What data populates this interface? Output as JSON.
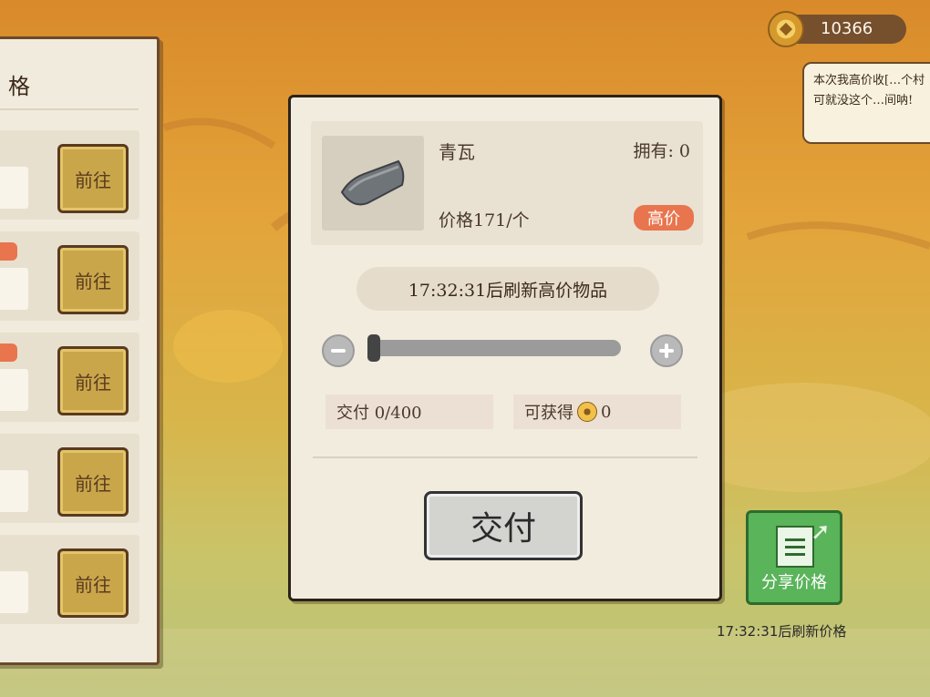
{
  "wallet": {
    "coins": "10366",
    "coin_icon": "copper-coin-icon"
  },
  "speech": {
    "text": "本次我高价收[…个村可就没这个…间呐!"
  },
  "left_panel": {
    "title": "格",
    "rows": [
      {
        "go_label": "前往"
      },
      {
        "go_label": "前往"
      },
      {
        "go_label": "前往"
      },
      {
        "go_label": "前往"
      },
      {
        "go_label": "前往"
      }
    ]
  },
  "item": {
    "name": "青瓦",
    "owned": "拥有: 0",
    "price": "价格171/个",
    "badge": "高价",
    "icon": "roof-tile-icon"
  },
  "refresh": {
    "text": "17:32:31后刷新高价物品"
  },
  "quantity": {
    "slider_fraction": 0
  },
  "deliver_info": {
    "text": "交付 0/400"
  },
  "reward_info": {
    "label": "可获得",
    "value": "0"
  },
  "actions": {
    "deliver_label": "交付"
  },
  "share": {
    "label": "分享价格",
    "refresh_text": "17:32:31后刷新价格"
  },
  "colors": {
    "accent": "#e8754e",
    "share_green": "#5ab45a",
    "gold_button": "#c9a64a"
  }
}
